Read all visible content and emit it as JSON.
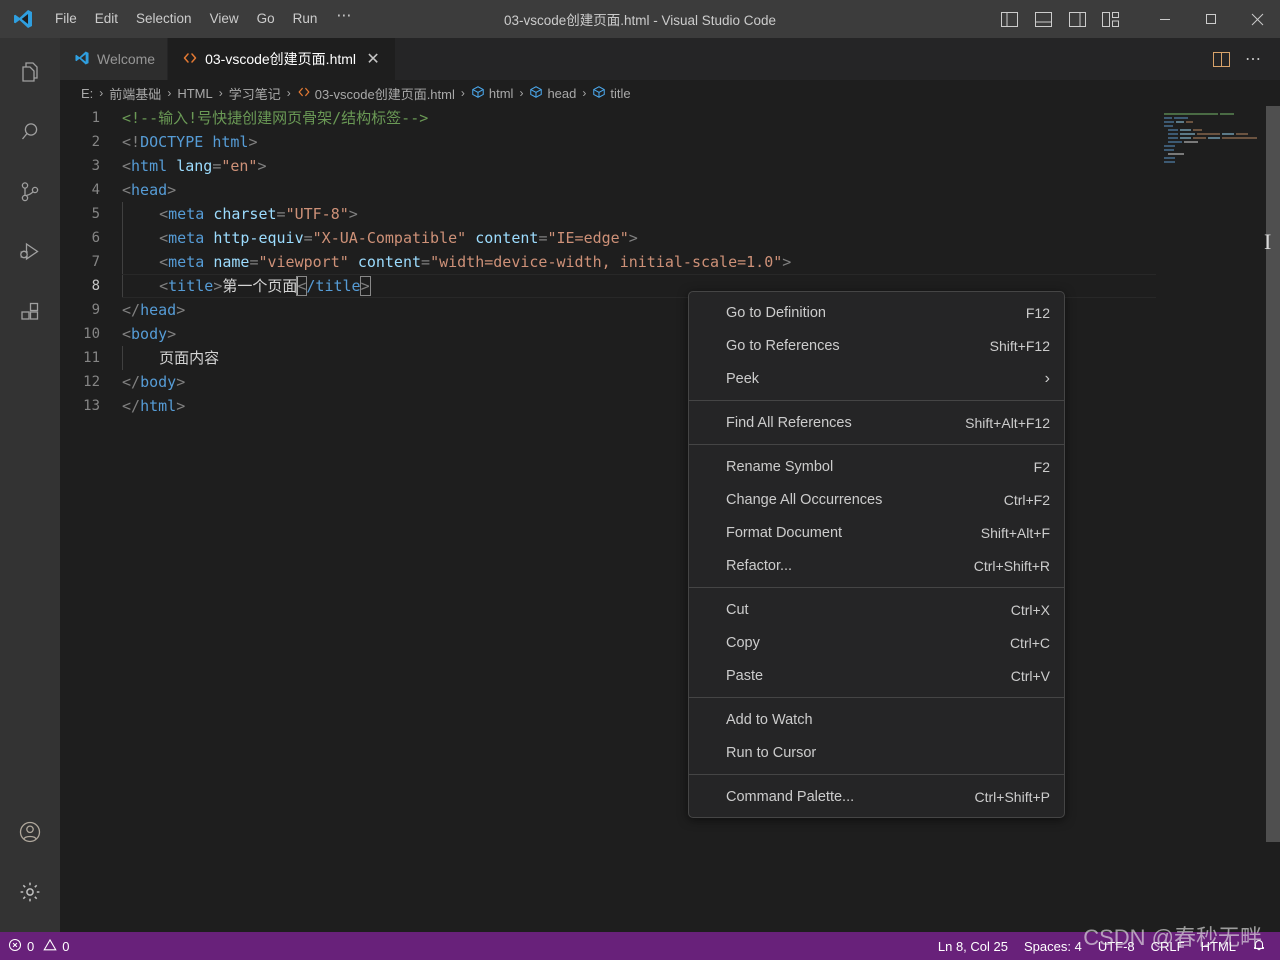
{
  "window": {
    "title": "03-vscode创建页面.html - Visual Studio Code",
    "menu": [
      "File",
      "Edit",
      "Selection",
      "View",
      "Go",
      "Run",
      "⋯"
    ],
    "controls": {
      "toggle_primary_sidebar": "toggle-primary-sidebar",
      "toggle_panel": "toggle-panel",
      "toggle_secondary_sidebar": "toggle-secondary-sidebar",
      "customize_layout": "customize-layout",
      "minimize": "—",
      "maximize": "□",
      "close": "✕"
    }
  },
  "activitybar": {
    "items": [
      {
        "name": "explorer",
        "icon": "files-icon"
      },
      {
        "name": "search",
        "icon": "search-icon"
      },
      {
        "name": "source-control",
        "icon": "source-control-icon"
      },
      {
        "name": "run-and-debug",
        "icon": "run-debug-icon"
      },
      {
        "name": "extensions",
        "icon": "extensions-icon"
      }
    ],
    "bottom": [
      {
        "name": "accounts",
        "icon": "account-icon"
      },
      {
        "name": "manage",
        "icon": "gear-icon"
      }
    ]
  },
  "tabs": [
    {
      "label": "Welcome",
      "icon": "vscode-icon",
      "active": false,
      "closable": false
    },
    {
      "label": "03-vscode创建页面.html",
      "icon": "html-icon",
      "active": true,
      "closable": true,
      "close_glyph": "✕"
    }
  ],
  "tab_actions": [
    {
      "name": "split-editor",
      "icon": "split-editor-icon"
    },
    {
      "name": "more-actions",
      "icon": "ellipsis-icon",
      "glyph": "⋯"
    }
  ],
  "breadcrumb": {
    "separator": "›",
    "items": [
      {
        "label": "E:",
        "icon": null
      },
      {
        "label": "前端基础",
        "icon": null
      },
      {
        "label": "HTML",
        "icon": null
      },
      {
        "label": "学习笔记",
        "icon": null
      },
      {
        "label": "03-vscode创建页面.html",
        "icon": "html-icon"
      },
      {
        "label": "html",
        "icon": "symbol-icon"
      },
      {
        "label": "head",
        "icon": "symbol-icon"
      },
      {
        "label": "title",
        "icon": "symbol-icon"
      }
    ]
  },
  "editor": {
    "language": "html",
    "lines": [
      {
        "n": 1,
        "text": "<!--输入!号快捷创建网页骨架/结构标签-->"
      },
      {
        "n": 2,
        "text": "<!DOCTYPE html>"
      },
      {
        "n": 3,
        "text": "<html lang=\"en\">"
      },
      {
        "n": 4,
        "text": "<head>"
      },
      {
        "n": 5,
        "text": "    <meta charset=\"UTF-8\">"
      },
      {
        "n": 6,
        "text": "    <meta http-equiv=\"X-UA-Compatible\" content=\"IE=edge\">"
      },
      {
        "n": 7,
        "text": "    <meta name=\"viewport\" content=\"width=device-width, initial-scale=1.0\">"
      },
      {
        "n": 8,
        "text": "    <title>第一个页面</title>"
      },
      {
        "n": 9,
        "text": "</head>"
      },
      {
        "n": 10,
        "text": "<body>"
      },
      {
        "n": 11,
        "text": "    页面内容"
      },
      {
        "n": 12,
        "text": "</body>"
      },
      {
        "n": 13,
        "text": "</html>"
      }
    ],
    "cursor_line": 8
  },
  "context_menu": {
    "groups": [
      [
        {
          "label": "Go to Definition",
          "key": "F12"
        },
        {
          "label": "Go to References",
          "key": "Shift+F12"
        },
        {
          "label": "Peek",
          "key": "",
          "submenu": true,
          "chevron": "›"
        }
      ],
      [
        {
          "label": "Find All References",
          "key": "Shift+Alt+F12"
        }
      ],
      [
        {
          "label": "Rename Symbol",
          "key": "F2"
        },
        {
          "label": "Change All Occurrences",
          "key": "Ctrl+F2"
        },
        {
          "label": "Format Document",
          "key": "Shift+Alt+F"
        },
        {
          "label": "Refactor...",
          "key": "Ctrl+Shift+R"
        }
      ],
      [
        {
          "label": "Cut",
          "key": "Ctrl+X"
        },
        {
          "label": "Copy",
          "key": "Ctrl+C"
        },
        {
          "label": "Paste",
          "key": "Ctrl+V"
        }
      ],
      [
        {
          "label": "Add to Watch",
          "key": ""
        },
        {
          "label": "Run to Cursor",
          "key": ""
        }
      ],
      [
        {
          "label": "Command Palette...",
          "key": "Ctrl+Shift+P"
        }
      ]
    ]
  },
  "statusbar": {
    "background": "#68217a",
    "errors": "0",
    "warnings": "0",
    "position": "Ln 8, Col 25",
    "indentation": "Spaces: 4",
    "encoding": "UTF-8",
    "eol": "CRLF",
    "language": "HTML",
    "notifications_icon": "bell-icon"
  },
  "watermark": "CSDN @春秒无畔",
  "colors": {
    "titlebar_bg": "#3c3c3c",
    "activitybar_bg": "#333333",
    "editor_bg": "#1e1e1e",
    "tabbar_bg": "#252526",
    "statusbar_bg": "#68217a",
    "menu_bg": "#252526",
    "menu_border": "#454545",
    "token_comment": "#6a9955",
    "token_tag": "#569cd6",
    "token_attribute": "#9cdcfe",
    "token_string": "#ce9178",
    "token_punctuation": "#808080",
    "token_text": "#d4d4d4",
    "accent_orange": "#e37933"
  }
}
